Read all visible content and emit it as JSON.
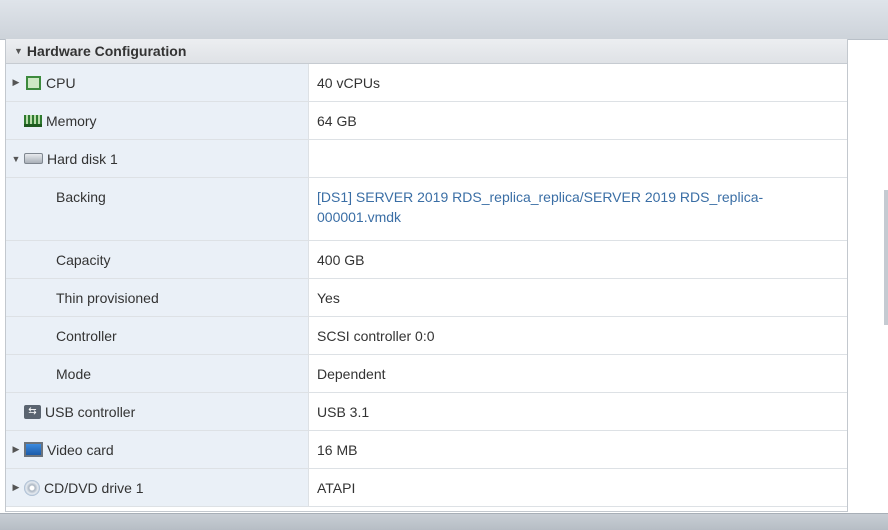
{
  "section": {
    "title": "Hardware Configuration"
  },
  "rows": {
    "cpu": {
      "label": "CPU",
      "value": "40 vCPUs"
    },
    "memory": {
      "label": "Memory",
      "value": "64 GB"
    },
    "hard_disk": {
      "label": "Hard disk 1",
      "value": ""
    },
    "backing": {
      "label": "Backing",
      "value": "[DS1] SERVER 2019 RDS_replica_replica/SERVER 2019 RDS_replica-000001.vmdk"
    },
    "capacity": {
      "label": "Capacity",
      "value": "400 GB"
    },
    "thin": {
      "label": "Thin provisioned",
      "value": "Yes"
    },
    "controller": {
      "label": "Controller",
      "value": "SCSI controller 0:0"
    },
    "mode": {
      "label": "Mode",
      "value": "Dependent"
    },
    "usb": {
      "label": "USB controller",
      "value": "USB 3.1"
    },
    "video": {
      "label": "Video card",
      "value": "16 MB"
    },
    "cddvd": {
      "label": "CD/DVD drive 1",
      "value": "ATAPI"
    }
  },
  "icons": {
    "cpu": "cpu-icon",
    "memory": "memory-icon",
    "disk": "hard-disk-icon",
    "usb": "usb-icon",
    "video": "video-card-icon",
    "cddvd": "cd-dvd-icon"
  }
}
